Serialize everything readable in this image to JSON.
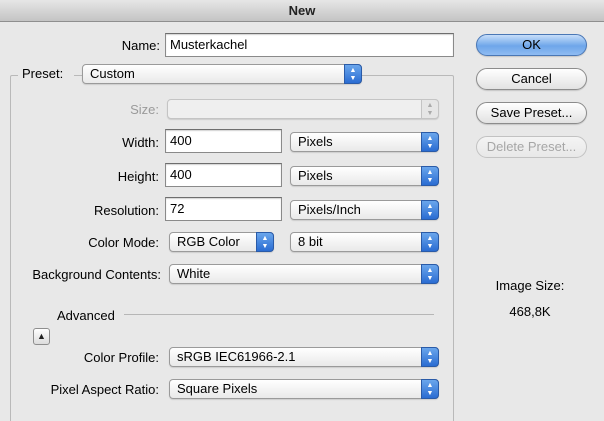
{
  "window": {
    "title": "New"
  },
  "name": {
    "label": "Name:",
    "value": "Musterkachel"
  },
  "preset": {
    "label": "Preset:",
    "value": "Custom"
  },
  "size": {
    "label": "Size:",
    "value": ""
  },
  "width": {
    "label": "Width:",
    "value": "400",
    "unit": "Pixels"
  },
  "height": {
    "label": "Height:",
    "value": "400",
    "unit": "Pixels"
  },
  "resolution": {
    "label": "Resolution:",
    "value": "72",
    "unit": "Pixels/Inch"
  },
  "color_mode": {
    "label": "Color Mode:",
    "value": "RGB Color",
    "depth": "8 bit"
  },
  "background": {
    "label": "Background Contents:",
    "value": "White"
  },
  "advanced": {
    "label": "Advanced"
  },
  "color_profile": {
    "label": "Color Profile:",
    "value": "sRGB IEC61966-2.1"
  },
  "pixel_aspect": {
    "label": "Pixel Aspect Ratio:",
    "value": "Square Pixels"
  },
  "buttons": {
    "ok": "OK",
    "cancel": "Cancel",
    "save_preset": "Save Preset...",
    "delete_preset": "Delete Preset..."
  },
  "image_size": {
    "label": "Image Size:",
    "value": "468,8K"
  },
  "icons": {
    "popup": "up-down-arrows",
    "disclosure": "triangle-up"
  }
}
